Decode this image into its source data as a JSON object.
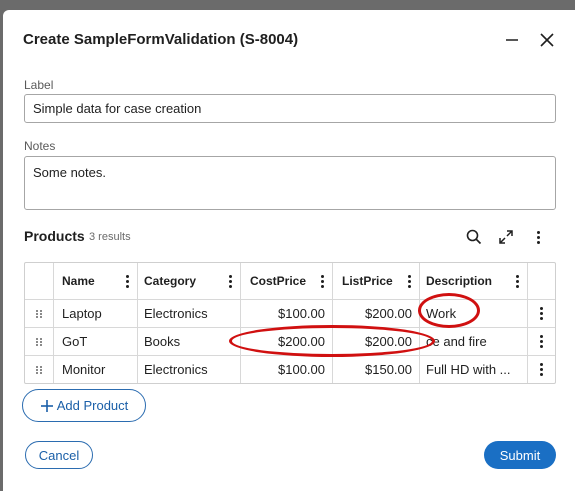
{
  "dialog": {
    "title": "Create SampleFormValidation (S-8004)",
    "minimize_icon": "minimize-icon",
    "close_icon": "close-icon"
  },
  "form": {
    "label_caption": "Label",
    "label_value": "Simple data for case creation",
    "notes_caption": "Notes",
    "notes_value": "Some notes."
  },
  "products": {
    "title": "Products",
    "count": "3 results",
    "toolbar_icons": [
      "search-icon",
      "expand-icon",
      "more-vertical-icon"
    ],
    "columns": [
      "Name",
      "Category",
      "CostPrice",
      "ListPrice",
      "Description"
    ],
    "rows": [
      {
        "name": "Laptop",
        "category": "Electronics",
        "cost": "$100.00",
        "list": "$200.00",
        "description": "Work"
      },
      {
        "name": "GoT",
        "category": "Books",
        "cost": "$200.00",
        "list": "$200.00",
        "description": "ce and fire"
      },
      {
        "name": "Monitor",
        "category": "Electronics",
        "cost": "$100.00",
        "list": "$150.00",
        "description": "Full HD with ..."
      }
    ],
    "add_label": "Add Product"
  },
  "actions": {
    "cancel_label": "Cancel",
    "submit_label": "Submit"
  },
  "colors": {
    "accent": "#1a6fc4",
    "annotation": "#d01010",
    "overlay": "#6b6b6b"
  }
}
